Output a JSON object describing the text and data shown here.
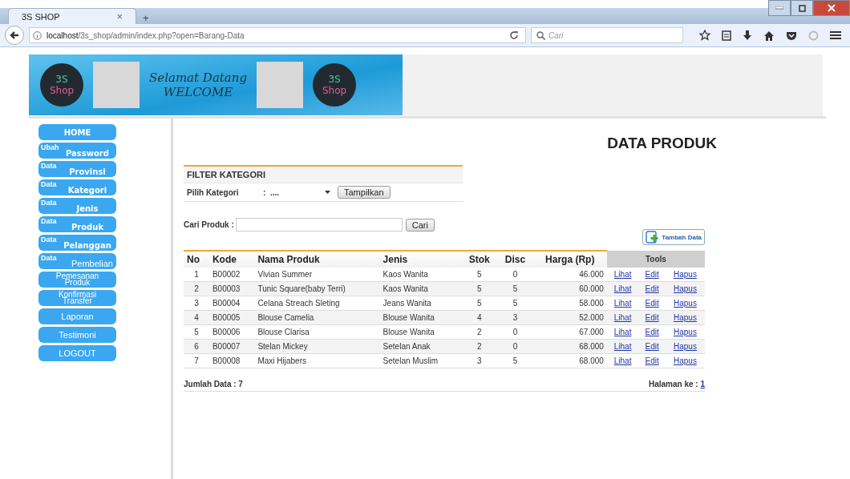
{
  "browser": {
    "tab_title": "3S SHOP",
    "tab_close": "×",
    "new_tab": "+",
    "url_host": "localhost",
    "url_path": "/3s_shop/admin/index.php?open=Barang-Data",
    "search_placeholder": "Cari"
  },
  "banner": {
    "logos": [
      {
        "top": "3S",
        "bottom": "Shop"
      },
      {
        "top": "3S",
        "bottom": "Shop"
      }
    ],
    "greeting": "Selamat Datang",
    "welcome": "WELCOME"
  },
  "sidebar": {
    "items": [
      {
        "kind": "heading",
        "label": "HOME"
      },
      {
        "kind": "split",
        "prefix": "Ubah",
        "label": "Password"
      },
      {
        "kind": "split",
        "prefix": "Data",
        "label": "Provinsi"
      },
      {
        "kind": "split",
        "prefix": "Data",
        "label": "Kategori"
      },
      {
        "kind": "split",
        "prefix": "Data",
        "label": "Jenis"
      },
      {
        "kind": "split",
        "prefix": "Data",
        "label": "Produk"
      },
      {
        "kind": "split",
        "prefix": "Data",
        "label": "Pelanggan"
      },
      {
        "kind": "split_plain",
        "prefix": "Data",
        "label": "Pembelian"
      },
      {
        "kind": "double",
        "lines": [
          "Pemesanan",
          "Produk"
        ]
      },
      {
        "kind": "double",
        "lines": [
          "Konfirmasi",
          "Transfer"
        ]
      },
      {
        "kind": "single",
        "label": "Laporan"
      },
      {
        "kind": "single",
        "label": "Testimoni"
      },
      {
        "kind": "single",
        "label": "LOGOUT"
      }
    ]
  },
  "page_title": "DATA PRODUK",
  "filter": {
    "title": "FILTER KATEGORI",
    "label": "Pilih Kategori",
    "colon": ":",
    "value": "....",
    "button": "Tampilkan"
  },
  "search": {
    "label": "Cari Produk :",
    "button": "Cari"
  },
  "add_button": "Tambah Data",
  "table": {
    "columns": [
      "No",
      "Kode",
      "Nama Produk",
      "Jenis",
      "Stok",
      "Disc",
      "Harga (Rp)"
    ],
    "tools_header": "Tools",
    "rows": [
      {
        "cells": [
          "1",
          "B00002",
          "Vivian Summer",
          "Kaos Wanita",
          "5",
          "0",
          "46.000"
        ],
        "actions": [
          "Lihat",
          "Edit",
          "Hapus"
        ]
      },
      {
        "cells": [
          "2",
          "B00003",
          "Tunic Square(baby Terri)",
          "Kaos Wanita",
          "5",
          "5",
          "60.000"
        ],
        "actions": [
          "Lihat",
          "Edit",
          "Hapus"
        ]
      },
      {
        "cells": [
          "3",
          "B00004",
          "Celana Streach Sleting",
          "Jeans Wanita",
          "5",
          "5",
          "58.000"
        ],
        "actions": [
          "Lihat",
          "Edit",
          "Hapus"
        ]
      },
      {
        "cells": [
          "4",
          "B00005",
          "Blouse Camelia",
          "Blouse Wanita",
          "4",
          "3",
          "52.000"
        ],
        "actions": [
          "Lihat",
          "Edit",
          "Hapus"
        ]
      },
      {
        "cells": [
          "5",
          "B00006",
          "Blouse Clarisa",
          "Blouse Wanita",
          "2",
          "0",
          "67.000"
        ],
        "actions": [
          "Lihat",
          "Edit",
          "Hapus"
        ]
      },
      {
        "cells": [
          "6",
          "B00007",
          "Stelan Mickey",
          "Setelan Anak",
          "2",
          "0",
          "68.000"
        ],
        "actions": [
          "Lihat",
          "Edit",
          "Hapus"
        ]
      },
      {
        "cells": [
          "7",
          "B00008",
          "Maxi Hijabers",
          "Setelan Muslim",
          "3",
          "5",
          "68.000"
        ],
        "actions": [
          "Lihat",
          "Edit",
          "Hapus"
        ]
      }
    ]
  },
  "footer": {
    "count": "Jumlah Data : 7",
    "page_label": "Halaman ke :",
    "page": "1"
  }
}
